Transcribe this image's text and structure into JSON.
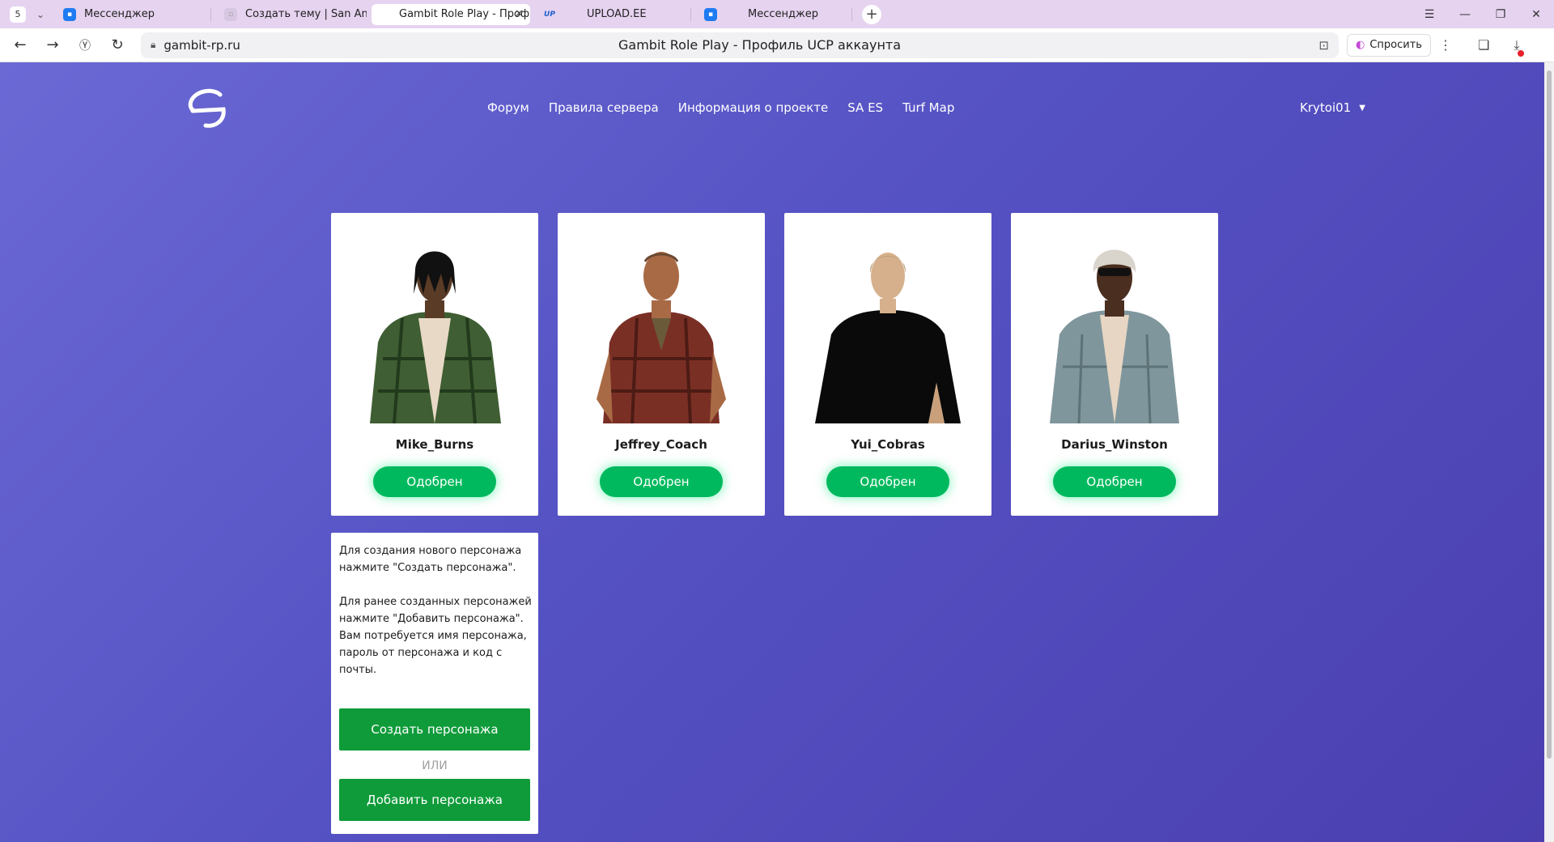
{
  "browser": {
    "tab_count": "5",
    "tabs": [
      {
        "label": "Мессенджер",
        "icon": "messenger-icon"
      },
      {
        "label": "Создать тему | San Andre",
        "icon": "forum-icon"
      },
      {
        "label": "Gambit Role Play - Проф",
        "icon": "page-icon",
        "active": true
      },
      {
        "label": "UPLOAD.EE",
        "icon": "upload-icon",
        "favicon_text": "UP"
      },
      {
        "label": "Мессенджер",
        "icon": "messenger-icon"
      }
    ],
    "url_host": "gambit-rp.ru",
    "page_title": "Gambit Role Play - Профиль UCP аккаунта",
    "ask_label": "Спросить"
  },
  "nav": {
    "items": [
      "Форум",
      "Правила сервера",
      "Информация о проекте",
      "SA ES",
      "Turf Map"
    ],
    "username": "Krytoi01"
  },
  "characters": [
    {
      "name": "Mike_Burns",
      "status": "Одобрен"
    },
    {
      "name": "Jeffrey_Coach",
      "status": "Одобрен"
    },
    {
      "name": "Yui_Cobras",
      "status": "Одобрен"
    },
    {
      "name": "Darius_Winston",
      "status": "Одобрен"
    }
  ],
  "info": {
    "text1": "Для создания нового персонажа нажмите \"Создать персонажа\".",
    "text2": "Для ранее созданных персонажей нажмите \"Добавить персонажа\". Вам потребуется имя персонажа, пароль от персонажа и код с почты.",
    "create_label": "Создать персонажа",
    "or_label": "ИЛИ",
    "add_label": "Добавить персонажа"
  },
  "colors": {
    "page_gradient_start": "#6b69d4",
    "page_gradient_end": "#4b3fb0",
    "status_green": "#00b95e",
    "action_green": "#0f9b3a",
    "tabstrip": "#e6d3f0"
  }
}
